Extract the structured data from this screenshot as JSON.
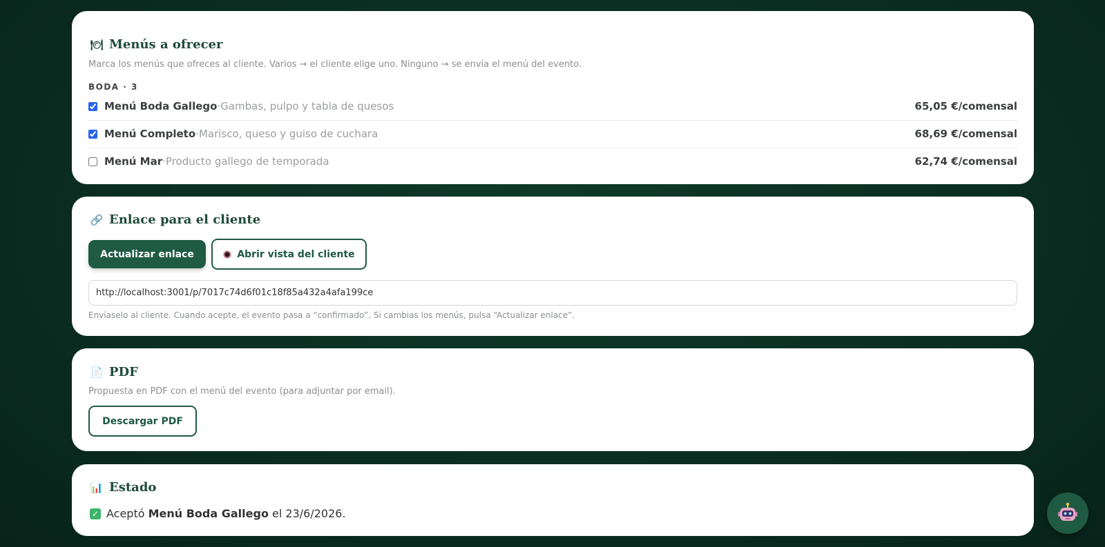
{
  "menus_card": {
    "icon": "plate-icon",
    "icon_glyph": "🍽",
    "title": "Menús a ofrecer",
    "description": "Marca los menús que ofreces al cliente. Varios → el cliente elige uno. Ninguno → se envía el menú del evento.",
    "group_label": "BODA · 3",
    "separator": " · ",
    "items": [
      {
        "checked": true,
        "name": "Menú Boda Gallego",
        "description": "Gambas, pulpo y tabla de quesos",
        "price": "65,05 €/comensal"
      },
      {
        "checked": true,
        "name": "Menú Completo",
        "description": "Marisco, queso y guiso de cuchara",
        "price": "68,69 €/comensal"
      },
      {
        "checked": false,
        "name": "Menú Mar",
        "description": "Producto gallego de temporada",
        "price": "62,74 €/comensal"
      }
    ]
  },
  "link_card": {
    "icon": "link-icon",
    "icon_glyph": "🔗",
    "title": "Enlace para el cliente",
    "update_button": "Actualizar enlace",
    "open_button": "Abrir vista del cliente",
    "open_button_icon": "eye-icon",
    "url_value": "http://localhost:3001/p/7017c74d6f01c18f85a432a4afa199ce",
    "hint": "Envíaselo al cliente. Cuando acepte, el evento pasa a “confirmado”. Si cambias los menús, pulsa “Actualizar enlace”."
  },
  "pdf_card": {
    "icon": "document-icon",
    "icon_glyph": "📄",
    "title": "PDF",
    "description": "Propuesta en PDF con el menú del evento (para adjuntar por email).",
    "download_button": "Descargar PDF"
  },
  "estado_card": {
    "icon": "bar-chart-icon",
    "icon_glyph": "📊",
    "title": "Estado",
    "status_icon": "check-icon",
    "status_prefix": "Aceptó ",
    "status_menu": "Menú Boda Gallego",
    "status_suffix": " el 23/6/2026."
  },
  "assistant": {
    "icon": "robot-icon"
  },
  "colors": {
    "accent": "#1f5a43",
    "background": "#0b2e22",
    "title": "#1f4a37",
    "checkbox": "#2563eb",
    "success": "#3fb36a"
  }
}
